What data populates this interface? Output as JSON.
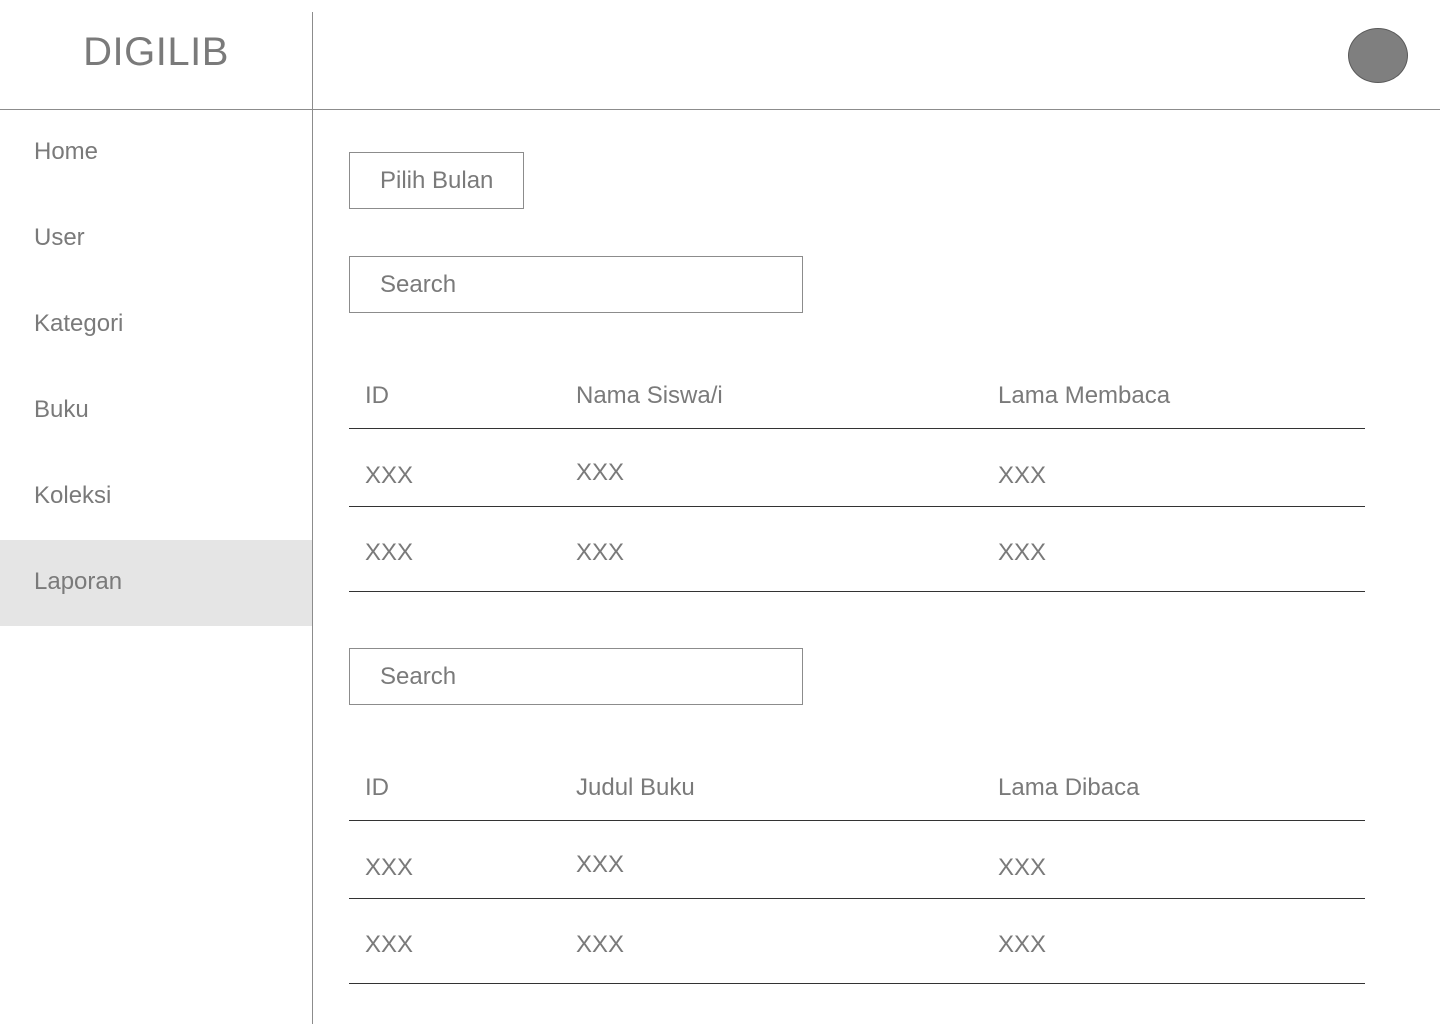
{
  "app": {
    "logo": "DIGILIB"
  },
  "sidebar": {
    "items": [
      {
        "label": "Home"
      },
      {
        "label": "User"
      },
      {
        "label": "Kategori"
      },
      {
        "label": "Buku"
      },
      {
        "label": "Koleksi"
      },
      {
        "label": "Laporan",
        "active": true
      }
    ]
  },
  "main": {
    "month_button": "Pilih Bulan",
    "search1": {
      "placeholder": "Search"
    },
    "table1": {
      "headers": [
        "ID",
        "Nama Siswa/i",
        "Lama Membaca"
      ],
      "rows": [
        [
          "XXX",
          "XXX",
          "XXX"
        ],
        [
          "XXX",
          "XXX",
          "XXX"
        ]
      ]
    },
    "search2": {
      "placeholder": "Search"
    },
    "table2": {
      "headers": [
        "ID",
        "Judul Buku",
        "Lama Dibaca"
      ],
      "rows": [
        [
          "XXX",
          "XXX",
          "XXX"
        ],
        [
          "XXX",
          "XXX",
          "XXX"
        ]
      ]
    }
  },
  "colors": {
    "text": "#7a7a7a",
    "active_nav_bg": "#e5e5e5",
    "avatar": "#7f7f7f",
    "divider": "#8c8c8c"
  }
}
